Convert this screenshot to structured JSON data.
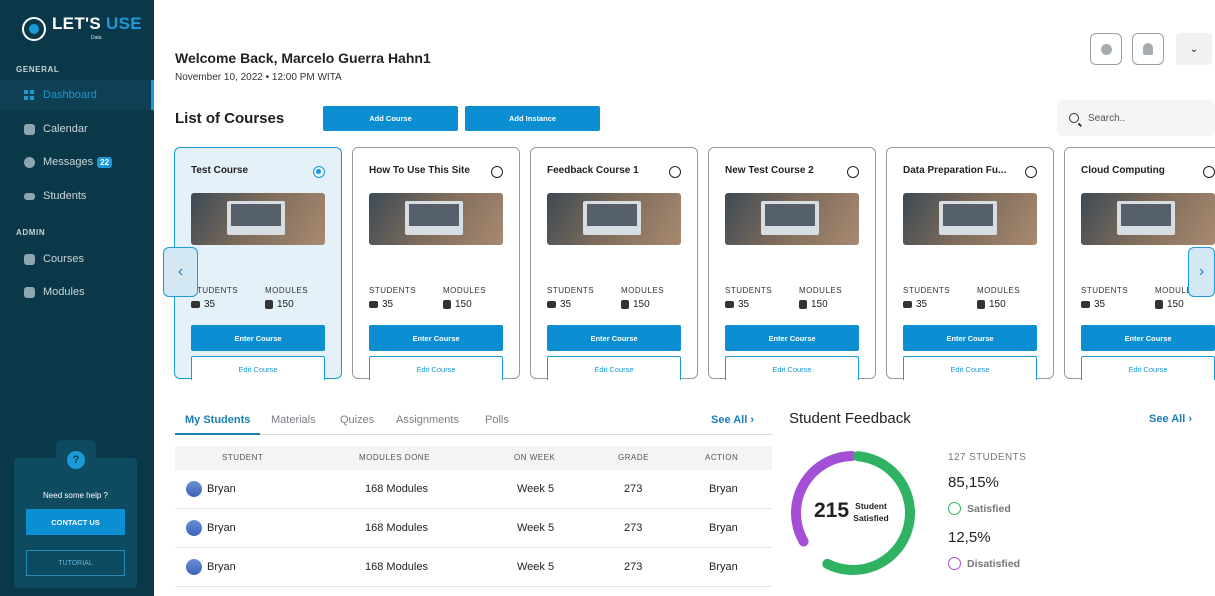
{
  "brand": {
    "name_a": "LET'S",
    "name_b": "USE",
    "sub": "Data"
  },
  "sidebar": {
    "general_label": "GENERAL",
    "admin_label": "ADMIN",
    "items": [
      {
        "label": "Dashboard",
        "icon": "dashboard-icon"
      },
      {
        "label": "Calendar",
        "icon": "calendar-icon"
      },
      {
        "label": "Messages",
        "icon": "messages-icon",
        "badge": "22"
      },
      {
        "label": "Students",
        "icon": "students-icon"
      }
    ],
    "admin_items": [
      {
        "label": "Courses",
        "icon": "courses-icon"
      },
      {
        "label": "Modules",
        "icon": "modules-icon"
      }
    ],
    "help": {
      "icon": "?",
      "text": "Need some help ?",
      "contact": "CONTACT US",
      "tutorial": "TUTORIAL"
    }
  },
  "header": {
    "welcome": "Welcome Back, Marcelo Guerra Hahn1",
    "date": "November 10, 2022 • 12:00 PM WITA",
    "chevron": "⌄"
  },
  "courses": {
    "title": "List of Courses",
    "add_course": "Add Course",
    "add_instance": "Add Instance",
    "search_placeholder": "Search..",
    "students_label": "STUDENTS",
    "modules_label": "MODULES",
    "enter_label": "Enter Course",
    "edit_label": "Edit Course",
    "prev": "‹",
    "next": "›",
    "items": [
      {
        "title": "Test Course",
        "students": "35",
        "modules": "150",
        "selected": true
      },
      {
        "title": "How To Use This Site",
        "students": "35",
        "modules": "150",
        "selected": false
      },
      {
        "title": "Feedback Course 1",
        "students": "35",
        "modules": "150",
        "selected": false
      },
      {
        "title": "New Test Course 2",
        "students": "35",
        "modules": "150",
        "selected": false
      },
      {
        "title": "Data Preparation Fu...",
        "students": "35",
        "modules": "150",
        "selected": false
      },
      {
        "title": "Cloud Computing",
        "students": "35",
        "modules": "150",
        "selected": false
      }
    ]
  },
  "students_panel": {
    "tabs": [
      "My Students",
      "Materials",
      "Quizes",
      "Assignments",
      "Polls"
    ],
    "see_all": "See All ›",
    "columns": [
      "STUDENT",
      "MODULES DONE",
      "ON WEEK",
      "GRADE",
      "ACTION"
    ],
    "rows": [
      {
        "student": "Bryan",
        "modules": "168 Modules",
        "week": "Week 5",
        "grade": "273",
        "action": "Bryan"
      },
      {
        "student": "Bryan",
        "modules": "168 Modules",
        "week": "Week 5",
        "grade": "273",
        "action": "Bryan"
      },
      {
        "student": "Bryan",
        "modules": "168 Modules",
        "week": "Week 5",
        "grade": "273",
        "action": "Bryan"
      }
    ]
  },
  "feedback": {
    "title": "Student Feedback",
    "see_all": "See All ›",
    "total": "215",
    "total_label_1": "Student",
    "total_label_2": "Satisfied",
    "students_count": "127 STUDENTS",
    "satisfied_pct": "85,15%",
    "satisfied_label": "Satisfied",
    "dissatisfied_pct": "12,5%",
    "dissatisfied_label": "Disatisfied",
    "colors": {
      "satisfied": "#2fb362",
      "dissatisfied": "#a34fd6"
    },
    "satisfied_fraction": 0.8515,
    "dissatisfied_fraction": 0.125
  }
}
